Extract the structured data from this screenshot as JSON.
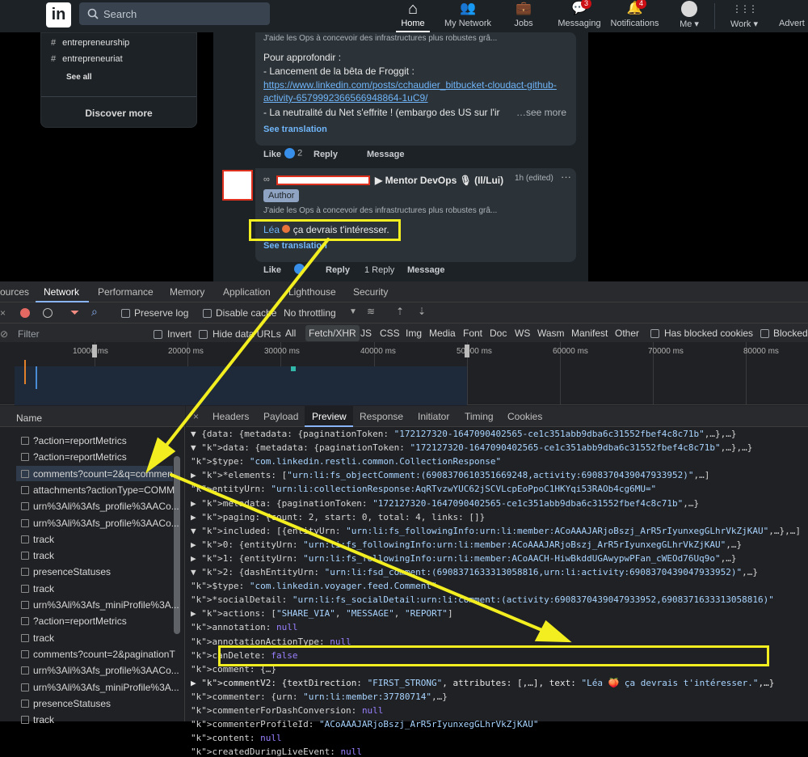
{
  "topbar": {
    "logo": "in",
    "search_placeholder": "Search",
    "nav": [
      {
        "label": "Home",
        "icon": "home-icon",
        "glyph": "⌂",
        "badge": ""
      },
      {
        "label": "My Network",
        "icon": "network-icon",
        "glyph": "👥",
        "badge": ""
      },
      {
        "label": "Jobs",
        "icon": "briefcase-icon",
        "glyph": "💼",
        "badge": ""
      },
      {
        "label": "Messaging",
        "icon": "messaging-icon",
        "glyph": "💬",
        "badge": "3"
      },
      {
        "label": "Notifications",
        "icon": "bell-icon",
        "glyph": "🔔",
        "badge": "4"
      },
      {
        "label": "Me ▾",
        "icon": "avatar-icon",
        "glyph": "●",
        "badge": ""
      },
      {
        "label": "Work ▾",
        "icon": "grid-icon",
        "glyph": "⋮⋮⋮",
        "badge": ""
      },
      {
        "label": "Advert",
        "icon": "",
        "glyph": "",
        "badge": ""
      }
    ]
  },
  "left_panel": {
    "tags": [
      "entrepreneurship",
      "entrepreneuriat"
    ],
    "see_all": "See all",
    "discover_more": "Discover more"
  },
  "post1": {
    "headline": "J'aide les Ops à concevoir des infrastructures plus robustes grâ...",
    "para_intro": "Pour approfondir :",
    "item1": "- Lancement de la bêta de Froggit :",
    "link1": "https://www.linkedin.com/posts/cchaudier_bitbucket-cloudact-github-activity-6579992366566948864-1uC9/",
    "item2": "- La neutralité du Net s'effrite ! (embargo des US sur l'ir",
    "see_more": "…see more",
    "see_translation": "See translation",
    "like": "Like",
    "reaction_count": "2",
    "reply": "Reply",
    "message": "Message"
  },
  "comment2": {
    "author_suffix": "▶ Mentor DevOps 🎙 (Il/Lui)",
    "time": "1h (edited)",
    "more": "···",
    "author_badge": "Author",
    "headline": "J'aide les Ops à concevoir des infrastructures plus robustes grâ...",
    "mention": "Léa",
    "text": " ça devrais t'intéresser.",
    "see_translation": "See translation",
    "like": "Like",
    "reply": "Reply",
    "replies": "1 Reply",
    "message": "Message"
  },
  "devtools": {
    "main_tabs": [
      "ources",
      "Network",
      "Performance",
      "Memory",
      "Application",
      "Lighthouse",
      "Security"
    ],
    "preserve_log": "Preserve log",
    "disable_cache": "Disable cache",
    "throttling": "No throttling",
    "filter_placeholder": "Filter",
    "invert": "Invert",
    "hide_data_urls": "Hide data URLs",
    "types": [
      "All",
      "Fetch/XHR",
      "JS",
      "CSS",
      "Img",
      "Media",
      "Font",
      "Doc",
      "WS",
      "Wasm",
      "Manifest",
      "Other"
    ],
    "has_blocked_cookies": "Has blocked cookies",
    "blocked": "Blocked",
    "timeline_ticks": [
      "10000 ms",
      "20000 ms",
      "30000 ms",
      "40000 ms",
      "50000 ms",
      "60000 ms",
      "70000 ms",
      "80000 ms"
    ],
    "name_header": "Name",
    "requests": [
      "?action=reportMetrics",
      "?action=reportMetrics",
      "comments?count=2&q=commen",
      "attachments?actionType=COMM",
      "urn%3Ali%3Afs_profile%3AACo...",
      "urn%3Ali%3Afs_profile%3AACo...",
      "track",
      "track",
      "presenceStatuses",
      "track",
      "urn%3Ali%3Afs_miniProfile%3A...",
      "?action=reportMetrics",
      "track",
      "comments?count=2&paginationT",
      "urn%3Ali%3Afs_profile%3AACo...",
      "urn%3Ali%3Afs_miniProfile%3A...",
      "presenceStatuses",
      "track"
    ],
    "detail_tabs": [
      "Headers",
      "Payload",
      "Preview",
      "Response",
      "Initiator",
      "Timing",
      "Cookies"
    ],
    "preview_lines": [
      "▼ {data: {metadata: {paginationToken: \"172127320-1647090402565-ce1c351abb9dba6c31552fbef4c8c71b\",…},…}",
      "  ▼ data: {metadata: {paginationToken: \"172127320-1647090402565-ce1c351abb9dba6c31552fbef4c8c71b\",…},…}",
      "      $type: \"com.linkedin.restli.common.CollectionResponse\"",
      "    ▶ *elements: [\"urn:li:fs_objectComment:(6908370610351669248,activity:6908370439047933952)\",…]",
      "      entityUrn: \"urn:li:collectionResponse:AqRTvzwYUC62jSCVLcpEoPpoC1HKYqi53RAOb4cg6MU=\"",
      "    ▶ metadata: {paginationToken: \"172127320-1647090402565-ce1c351abb9dba6c31552fbef4c8c71b\",…}",
      "    ▶ paging: {count: 2, start: 0, total: 4, links: []}",
      "  ▼ included: [{entityUrn: \"urn:li:fs_followingInfo:urn:li:member:ACoAAAJARjoBszj_ArR5rIyunxegGLhrVkZjKAU\",…},…]",
      "    ▶ 0: {entityUrn: \"urn:li:fs_followingInfo:urn:li:member:ACoAAAJARjoBszj_ArR5rIyunxegGLhrVkZjKAU\",…}",
      "    ▶ 1: {entityUrn: \"urn:li:fs_followingInfo:urn:li:member:ACoAACH-HiwBkddUGAwypwPFan_cWEOd76Uq9o\",…}",
      "    ▼ 2: {dashEntityUrn: \"urn:li:fsd_comment:(6908371633313058816,urn:li:activity:6908370439047933952)\",…}",
      "        $type: \"com.linkedin.voyager.feed.Comment\"",
      "        *socialDetail: \"urn:li:fs_socialDetail:urn:li:comment:(activity:6908370439047933952,6908371633313058816)\"",
      "      ▶ actions: [\"SHARE_VIA\", \"MESSAGE\", \"REPORT\"]",
      "        annotation: null",
      "        annotationActionType: null",
      "        canDelete: false",
      "        comment: {…}",
      "      ▶ commentV2: {textDirection: \"FIRST_STRONG\", attributes: [,…], text: \"Léa 🍑 ça devrais t'intéresser.\",…}",
      "        commenter: {urn: \"urn:li:member:37780714\",…}",
      "        commenterForDashConversion: null",
      "        commenterProfileId: \"ACoAAAJARjoBszj_ArR5rIyunxegGLhrVkZjKAU\"",
      "        content: null",
      "        createdDuringLiveEvent: null"
    ]
  },
  "colors": {
    "highlight": "#f2ee1f",
    "link": "#70b5f9",
    "badge_red": "#cc1016"
  }
}
